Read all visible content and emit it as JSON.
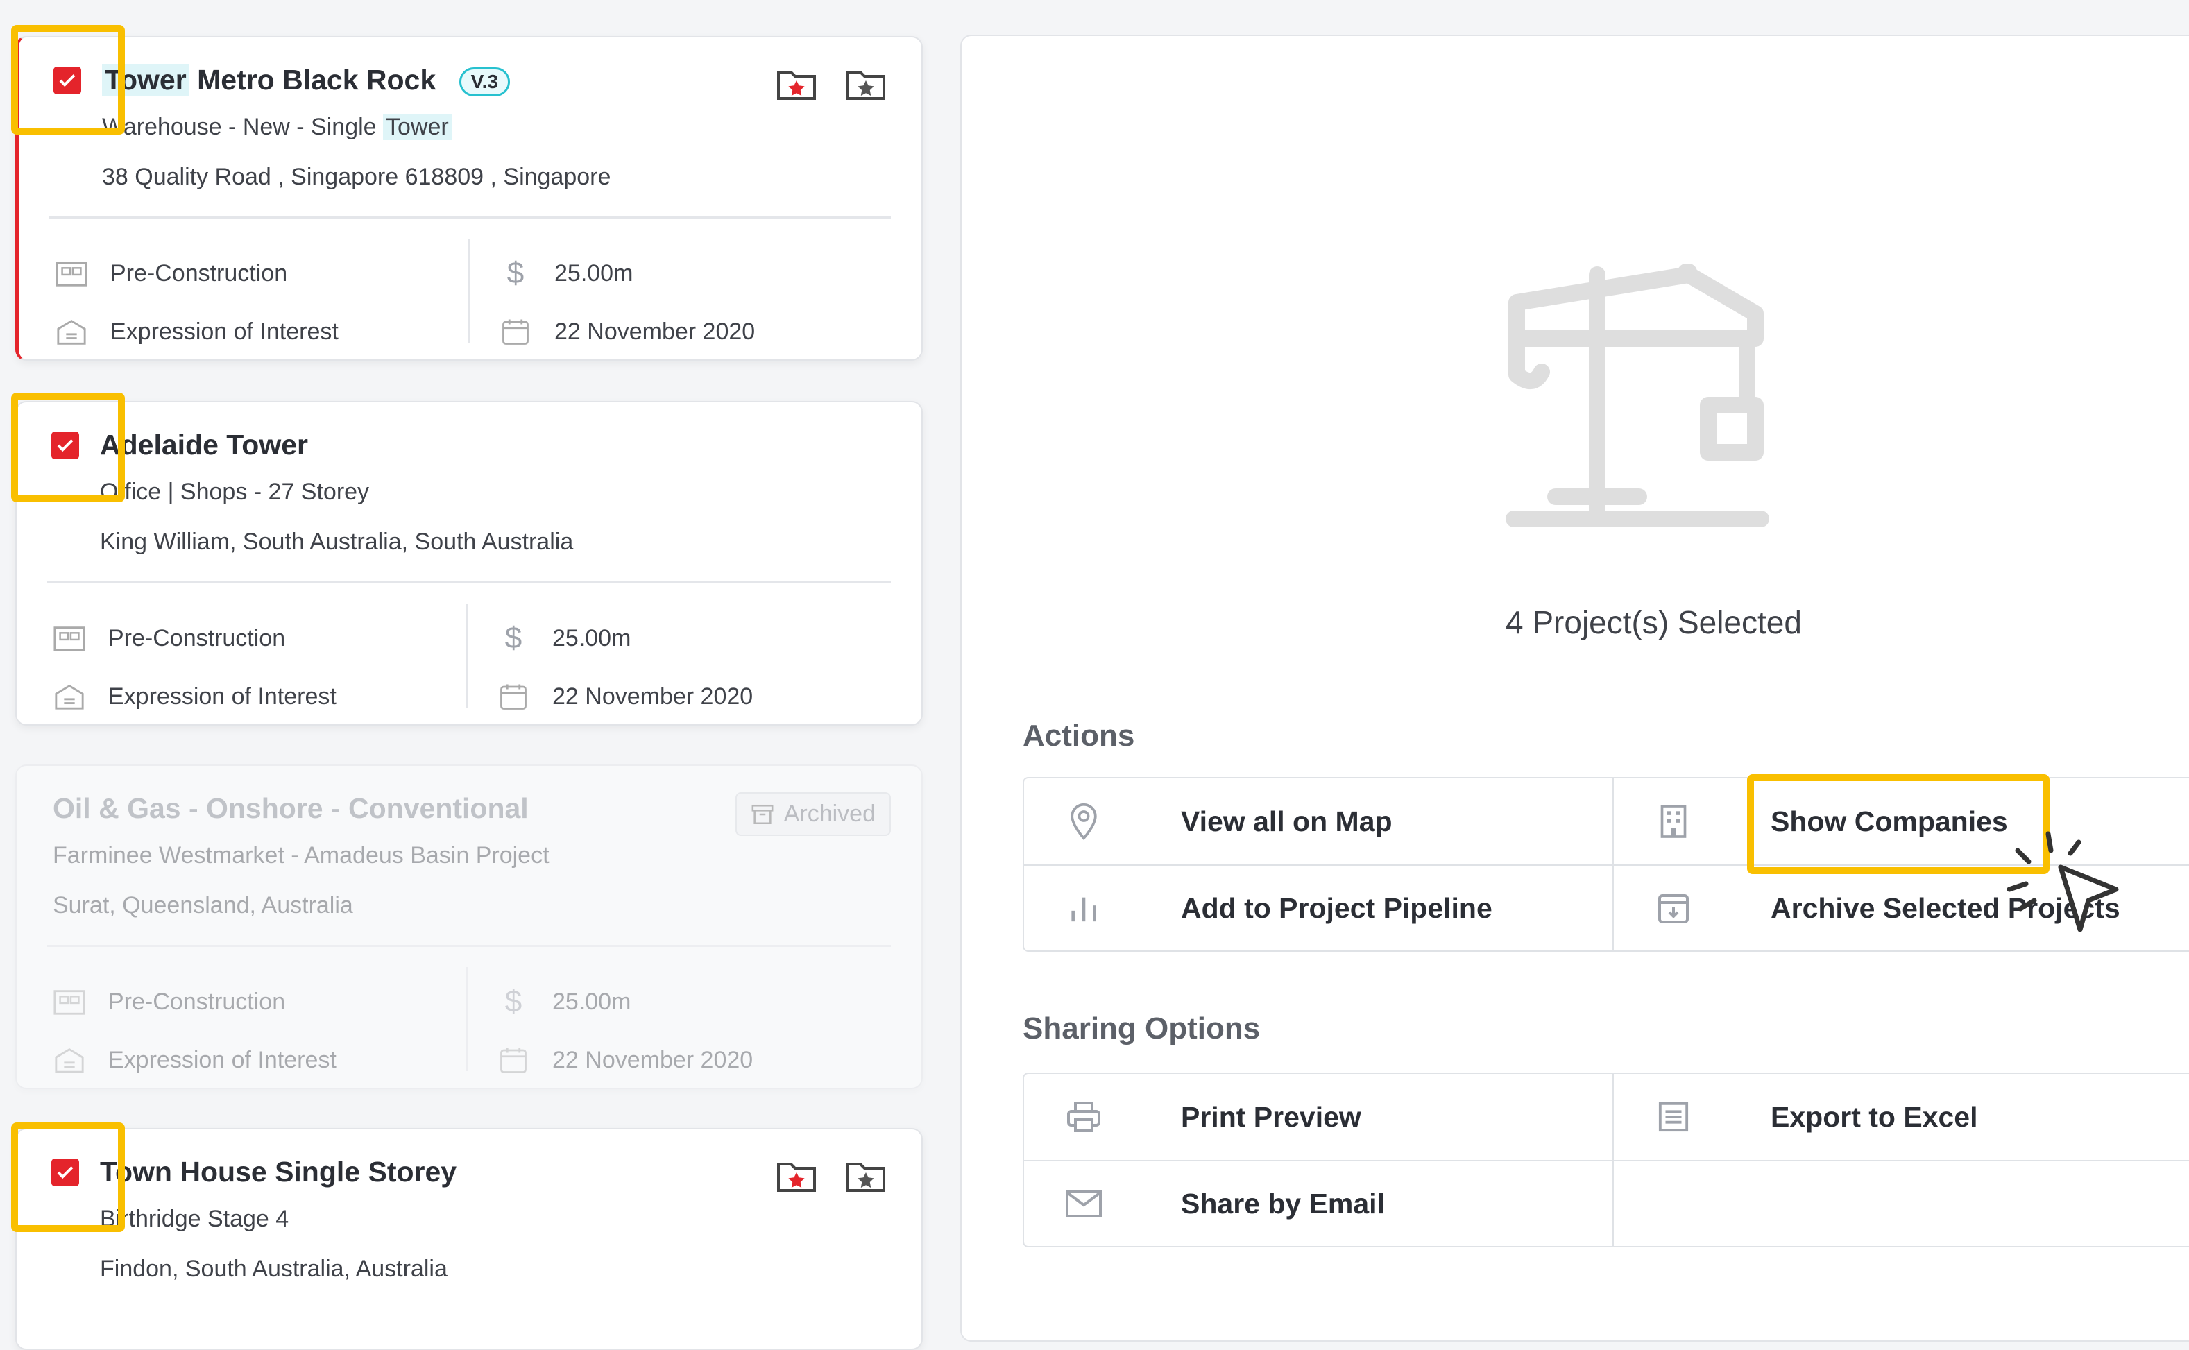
{
  "projects": [
    {
      "title_highlight": "Tower",
      "title_rest": " Metro Black Rock",
      "version": "V.3",
      "subtitle": "Warehouse - New - Single ",
      "subtitle_highlight": "Tower",
      "address": "38 Quality Road , Singapore 618809 , Singapore",
      "stage": "Pre-Construction",
      "value": "25.00m",
      "status": "Expression of Interest",
      "date": "22 November 2020"
    },
    {
      "title": "Adelaide Tower",
      "subtitle": "Office | Shops - 27 Storey",
      "address": "King William, South Australia, South Australia",
      "stage": "Pre-Construction",
      "value": "25.00m",
      "status": "Expression of Interest",
      "date": "22 November 2020"
    },
    {
      "title": "Oil & Gas - Onshore - Conventional",
      "subtitle": "Farminee Westmarket - Amadeus Basin Project",
      "address": "Surat, Queensland, Australia",
      "stage": "Pre-Construction",
      "value": "25.00m",
      "status": "Expression of Interest",
      "date": "22 November 2020",
      "badge": "Archived"
    },
    {
      "title": "Town House Single Storey",
      "subtitle": "Birthridge Stage 4",
      "address": "Findon, South Australia, Australia"
    }
  ],
  "summary": {
    "selected_text": "4 Project(s) Selected"
  },
  "actions": {
    "title": "Actions",
    "view_map": "View all on Map",
    "show_companies": "Show Companies",
    "add_pipeline": "Add to Project Pipeline",
    "archive_selected": "Archive Selected Projects"
  },
  "sharing": {
    "title": "Sharing Options",
    "print_preview": "Print Preview",
    "export_excel": "Export to Excel",
    "share_email": "Share by Email"
  },
  "colors": {
    "accent_red": "#e4242b",
    "highlight_yellow": "#f9bf00",
    "teal": "#27c1cf"
  }
}
